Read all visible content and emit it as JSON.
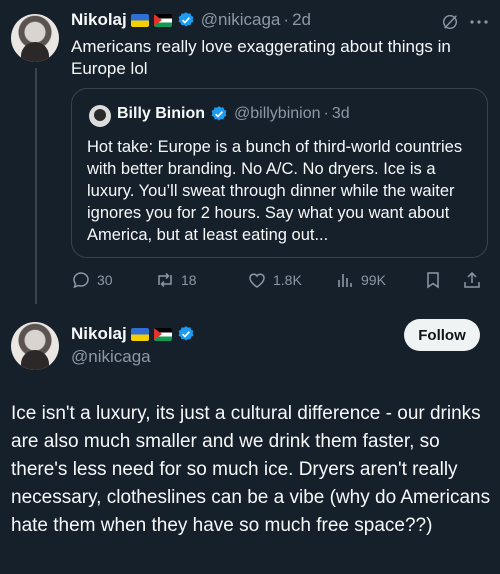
{
  "tweet": {
    "author_name": "Nikolaj",
    "handle": "@nikicaga",
    "separator": "·",
    "time": "2d",
    "text": "Americans really love exaggerating about things in Europe lol",
    "quote": {
      "author_name": "Billy Binion",
      "handle": "@billybinion",
      "separator": "·",
      "time": "3d",
      "text": "Hot take: Europe is a bunch of third-world countries with better branding. No A/C. No dryers. Ice is a luxury. You’ll sweat through dinner while the waiter ignores you for 2 hours. Say what you want about America, but at least eating out..."
    },
    "actions": {
      "replies": "30",
      "retweets": "18",
      "likes": "1.8K",
      "views": "99K"
    }
  },
  "reply": {
    "author_name": "Nikolaj",
    "handle": "@nikicaga",
    "follow_label": "Follow",
    "text": "Ice isn't a luxury, its just a cultural difference - our drinks are also much smaller and we drink them faster, so there's less need for so much ice. Dryers aren't really necessary, clotheslines can be a vibe (why do Americans hate them when they have so much free space??)"
  },
  "colors": {
    "background": "#15202b",
    "text": "#f7f9f9",
    "muted": "#8b98a5",
    "verified": "#1d9bf0",
    "border": "#38444d"
  },
  "icons": [
    "verified-badge-icon",
    "grok-icon",
    "more-icon",
    "reply-icon",
    "retweet-icon",
    "like-icon",
    "views-icon",
    "bookmark-icon",
    "share-icon",
    "flag-ukraine-icon",
    "flag-palestine-icon"
  ]
}
